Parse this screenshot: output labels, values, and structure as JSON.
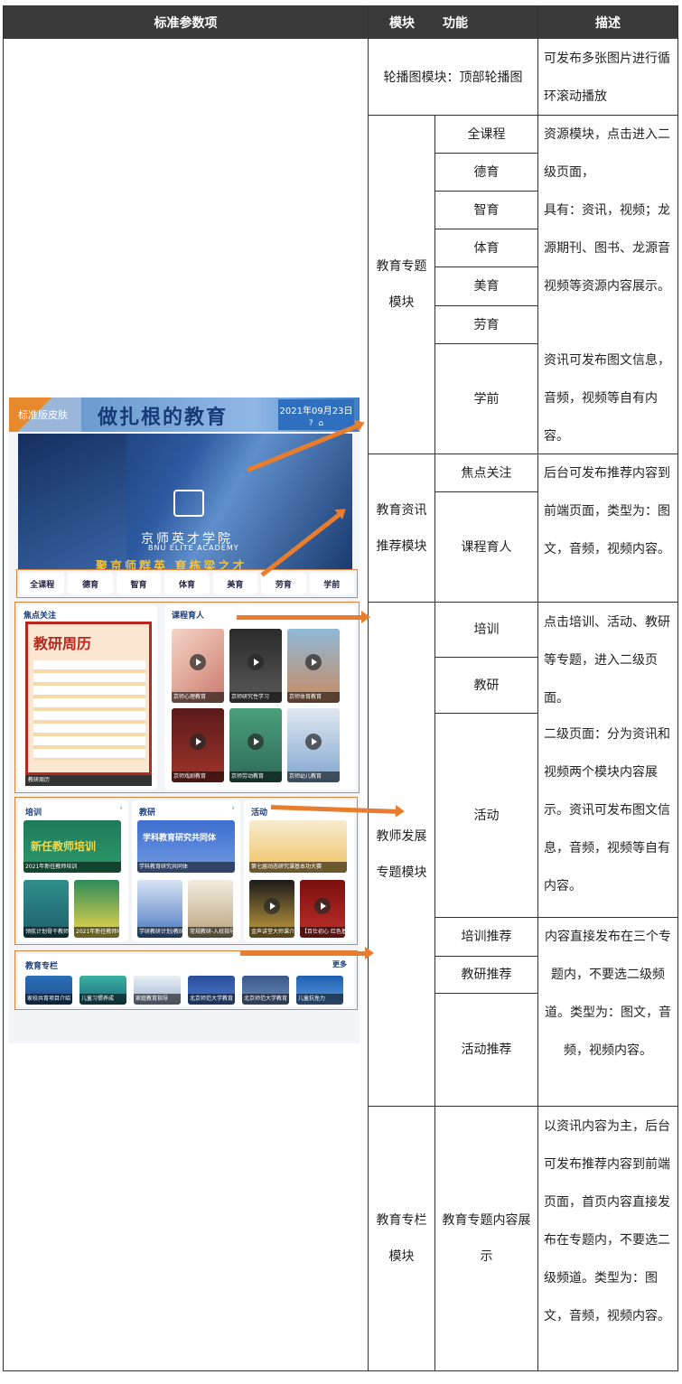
{
  "header": {
    "col1": "标准参数项",
    "col2a": "模块",
    "col2b": "功能",
    "col3": "描述"
  },
  "rows": {
    "carousel": {
      "module": "轮播图模块：顶部轮播图",
      "desc": "可发布多张图片进行循环滚动播放"
    },
    "topic": {
      "module": "教育专题模块",
      "funcs": [
        "全课程",
        "德育",
        "智育",
        "体育",
        "美育",
        "劳育",
        "学前"
      ],
      "desc1": "资源模块，点击进入二级页面，",
      "desc2": "具有：资讯，视频；龙源期刊、图书、龙源音视频等资源内容展示。",
      "desc3": "资讯可发布图文信息，音频，视频等自有内容。"
    },
    "news": {
      "module": "教育资讯推荐模块",
      "funcs": [
        "焦点关注",
        "课程育人"
      ],
      "desc": "后台可发布推荐内容到前端页面，类型为：图文，音频，视频内容。"
    },
    "teacher": {
      "module": "教师发展专题模块",
      "funcs": [
        "培训",
        "教研",
        "活动"
      ],
      "desc1": "点击培训、活动、教研等专题，进入二级页面。",
      "desc2": "二级页面：分为资讯和视频两个模块内容展示。资讯可发布图文信息，音频，视频等自有内容。",
      "recs": [
        "培训推荐",
        "教研推荐",
        "活动推荐"
      ],
      "desc3": "内容直接发布在三个专题内，不要选二级频道。类型为：图文，音频，视频内容。"
    },
    "column": {
      "module": "教育专栏模块",
      "func": "教育专题内容展示",
      "desc": "以资讯内容为主，后台可发布推荐内容到前端页面，首页内容直接发布在专题内，不要选二级频道。类型为：图文，音频，视频内容。"
    }
  },
  "screenshot": {
    "skin": "标准版皮肤",
    "brand": "做扎根的教育",
    "date": "2021年09月23日",
    "banner_title": "京师英才学院",
    "banner_en": "BNU ELITE ACADEMY",
    "banner_slogan": "聚京师群英 育栋梁之才",
    "nav": [
      "全课程",
      "德育",
      "智育",
      "体育",
      "美育",
      "劳育",
      "学前"
    ],
    "focus_title": "焦点关注",
    "focus_poster": "教研周历",
    "focus_caption": "教研周历",
    "course_title": "课程育人",
    "course_items": [
      "京师心理教育",
      "京师研究性学习",
      "京师体育教育",
      "京师戏剧教育",
      "京师劳动教育",
      "京师幼儿教育"
    ],
    "train_title": "培训",
    "train_banner": "新任教师培训",
    "train_cap": "2021年新任教师培训",
    "train_items": [
      "领航计划骨干教师培训",
      "2021年新任教师培训"
    ],
    "research_title": "教研",
    "research_banner": "学科教育研究共同体",
    "research_cap": "学科教育研究共同体",
    "research_items": [
      "学研教研计划/教研简报",
      "常规教研-入校指导"
    ],
    "activity_title": "活动",
    "activity_cap": "第七届动态研究课基本功大赛",
    "activity_items": [
      "金声讲堂大师课介绍-短片(高清版)",
      "【百仕初心 红色基因】01周高师"
    ],
    "column_title": "教育专栏",
    "column_more": "更多",
    "column_items": [
      "家校共育项目介绍",
      "儿童习惯养成",
      "家庭教育指导",
      "北京师范大学教育",
      "北京师范大学教育",
      "儿童抗挫力"
    ]
  }
}
